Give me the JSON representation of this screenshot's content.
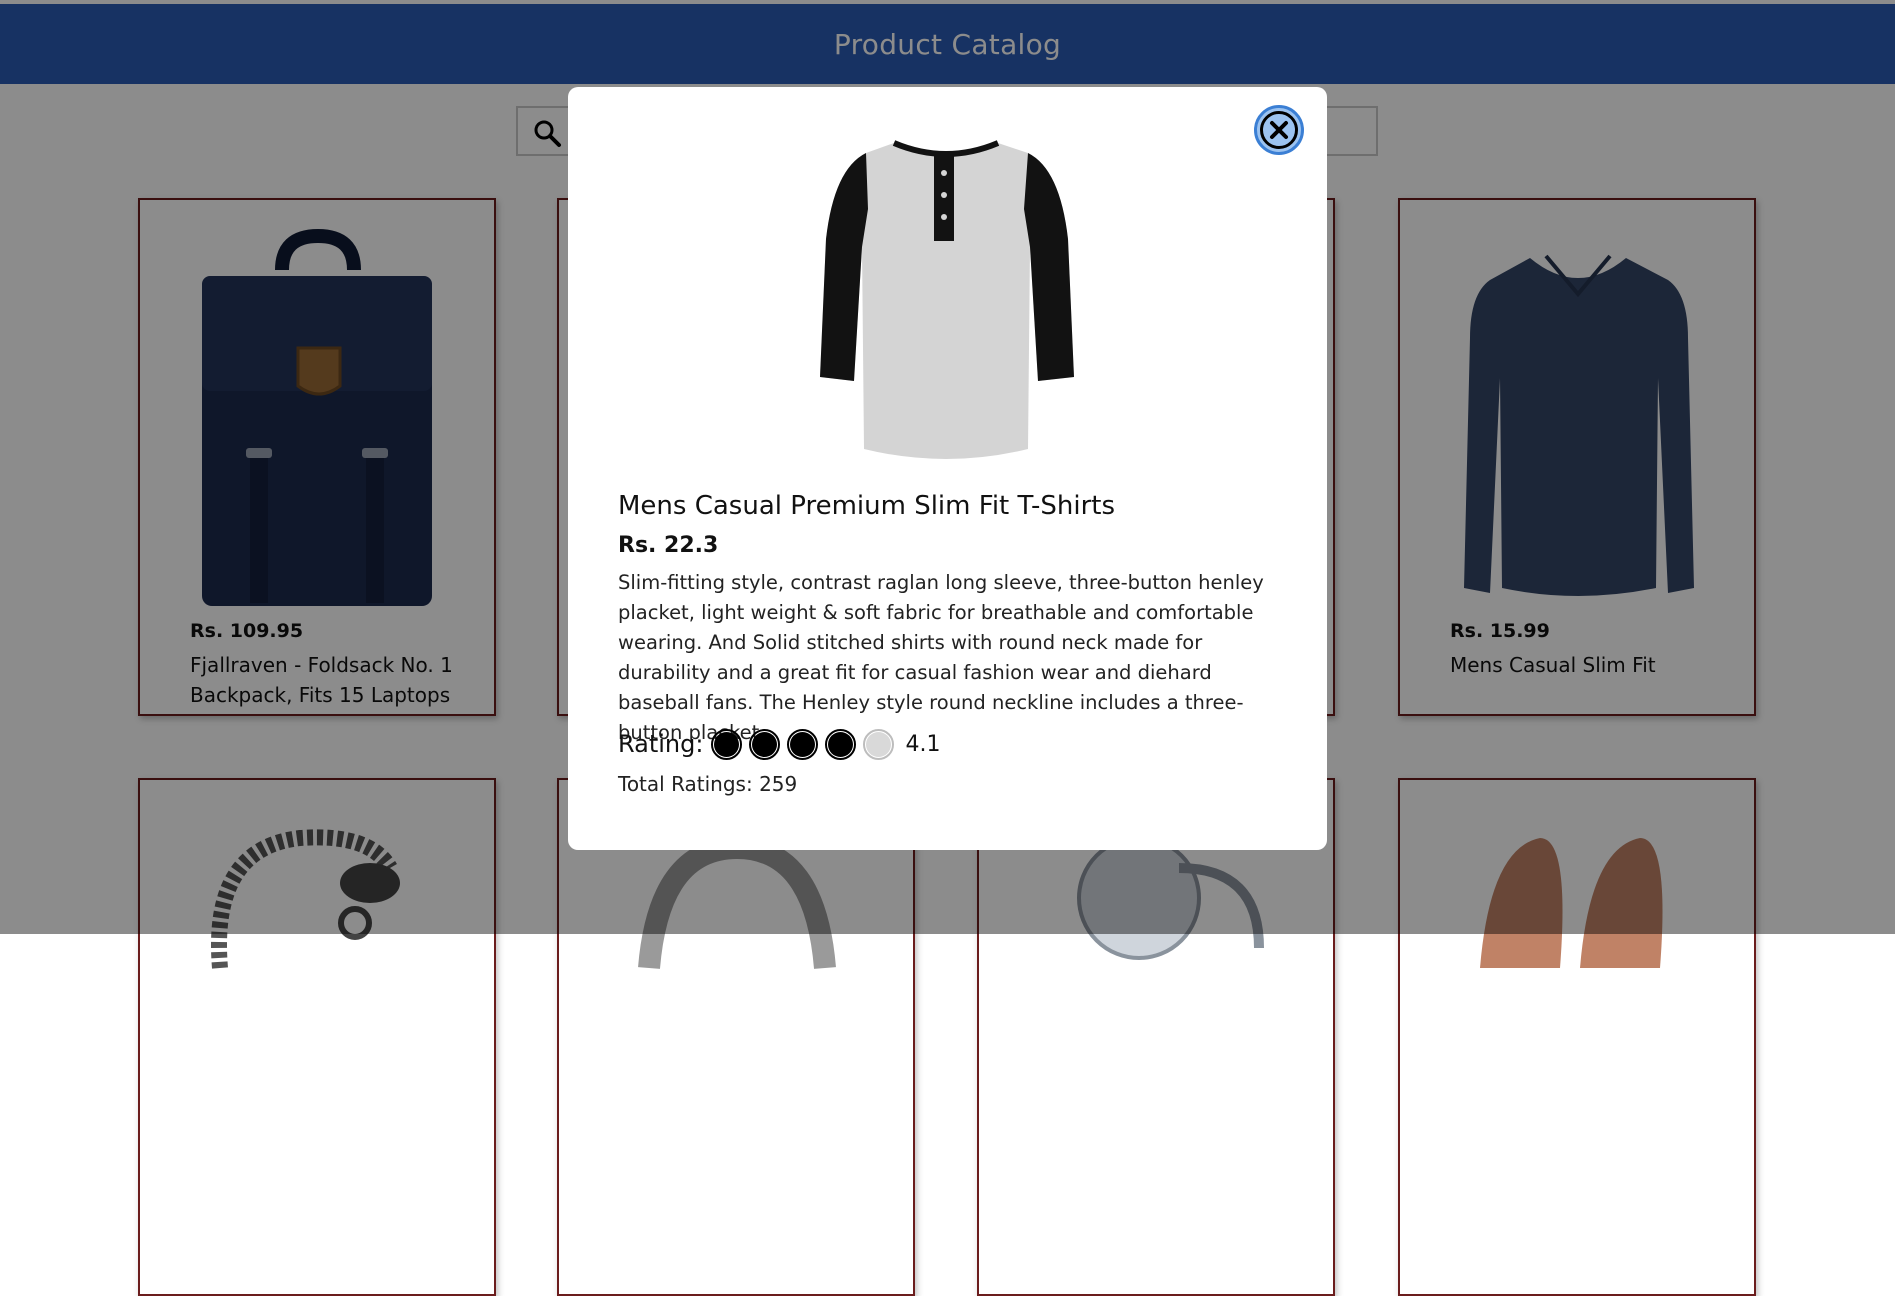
{
  "header": {
    "title": "Product Catalog",
    "color": "#2a5bb4"
  },
  "search": {
    "icon": "search-icon"
  },
  "cards": [
    {
      "price": "Rs. 109.95",
      "name": "Fjallraven - Foldsack No. 1 Backpack, Fits 15 Laptops"
    },
    {
      "price": "Rs. 15.99",
      "name": "Mens Casual Slim Fit"
    }
  ],
  "modal": {
    "title": "Mens Casual Premium Slim Fit T-Shirts",
    "price": "Rs. 22.3",
    "description": "Slim-fitting style, contrast raglan long sleeve, three-button henley placket, light weight & soft fabric for breathable and comfortable wearing. And Solid stitched shirts with round neck made for durability and a great fit for casual fashion wear and diehard baseball fans. The Henley style round neckline includes a three-button placket.",
    "rating_label": "Rating:",
    "rating_value": "4.1",
    "filled_dots": 4,
    "total_dots": 5,
    "total_ratings": "Total Ratings: 259",
    "close_icon": "close-icon",
    "close_color": "#9cc3f0"
  }
}
